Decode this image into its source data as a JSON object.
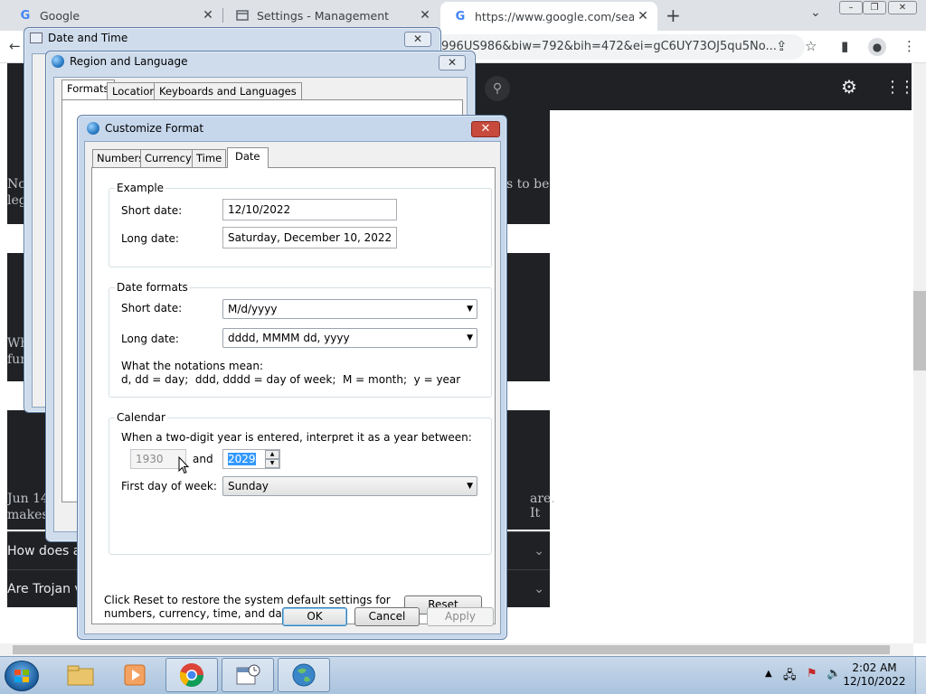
{
  "browser": {
    "tabs": [
      {
        "title": "Google"
      },
      {
        "title": "Settings - Management"
      },
      {
        "title": "https://www.google.com/search?"
      }
    ],
    "new_tab": "+",
    "address": "996US986&biw=792&bih=472&ei=gC6UY73OJ5qu5No...",
    "page": {
      "snippets": [
        {
          "text": "s to be"
        },
        {
          "text": "Jun 14"
        },
        {
          "text": "are. It"
        },
        {
          "text": "makes"
        },
        {
          "text": "No"
        },
        {
          "text": "leg"
        },
        {
          "text": "Wh"
        },
        {
          "text": "fun"
        }
      ],
      "faq": [
        {
          "text": "How does a"
        },
        {
          "text": "Are Trojan v"
        }
      ]
    }
  },
  "date_time_window": {
    "title": "Date and Time"
  },
  "region_window": {
    "title": "Region and Language",
    "tabs": [
      "Formats",
      "Location",
      "Keyboards and Languages"
    ]
  },
  "customize_format": {
    "title": "Customize Format",
    "tabs": [
      "Numbers",
      "Currency",
      "Time",
      "Date"
    ],
    "example": {
      "group_title": "Example",
      "short_label": "Short date:",
      "short_value": "12/10/2022",
      "long_label": "Long date:",
      "long_value": "Saturday, December 10, 2022"
    },
    "date_formats": {
      "group_title": "Date formats",
      "short_label": "Short date:",
      "short_value": "M/d/yyyy",
      "long_label": "Long date:",
      "long_value": "dddd, MMMM dd, yyyy",
      "notation_title": "What the notations mean:",
      "notation_text": "d, dd = day;  ddd, dddd = day of week;  M = month;  y = year"
    },
    "calendar": {
      "group_title": "Calendar",
      "two_digit_text": "When a two-digit year is entered, interpret it as a year between:",
      "year_from": "1930",
      "and_label": "and",
      "year_to": "2029",
      "first_day_label": "First day of week:",
      "first_day_value": "Sunday"
    },
    "reset_text_line1": "Click Reset to restore the system default settings for",
    "reset_text_line2": "numbers, currency, time, and date.",
    "reset_button": "Reset",
    "ok_button": "OK",
    "cancel_button": "Cancel",
    "apply_button": "Apply"
  },
  "taskbar": {
    "time": "2:02 AM",
    "date": "12/10/2022"
  },
  "colors": {
    "accent": "#1a73e8",
    "dark_page": "#202124",
    "close_red": "#c74a3c"
  }
}
